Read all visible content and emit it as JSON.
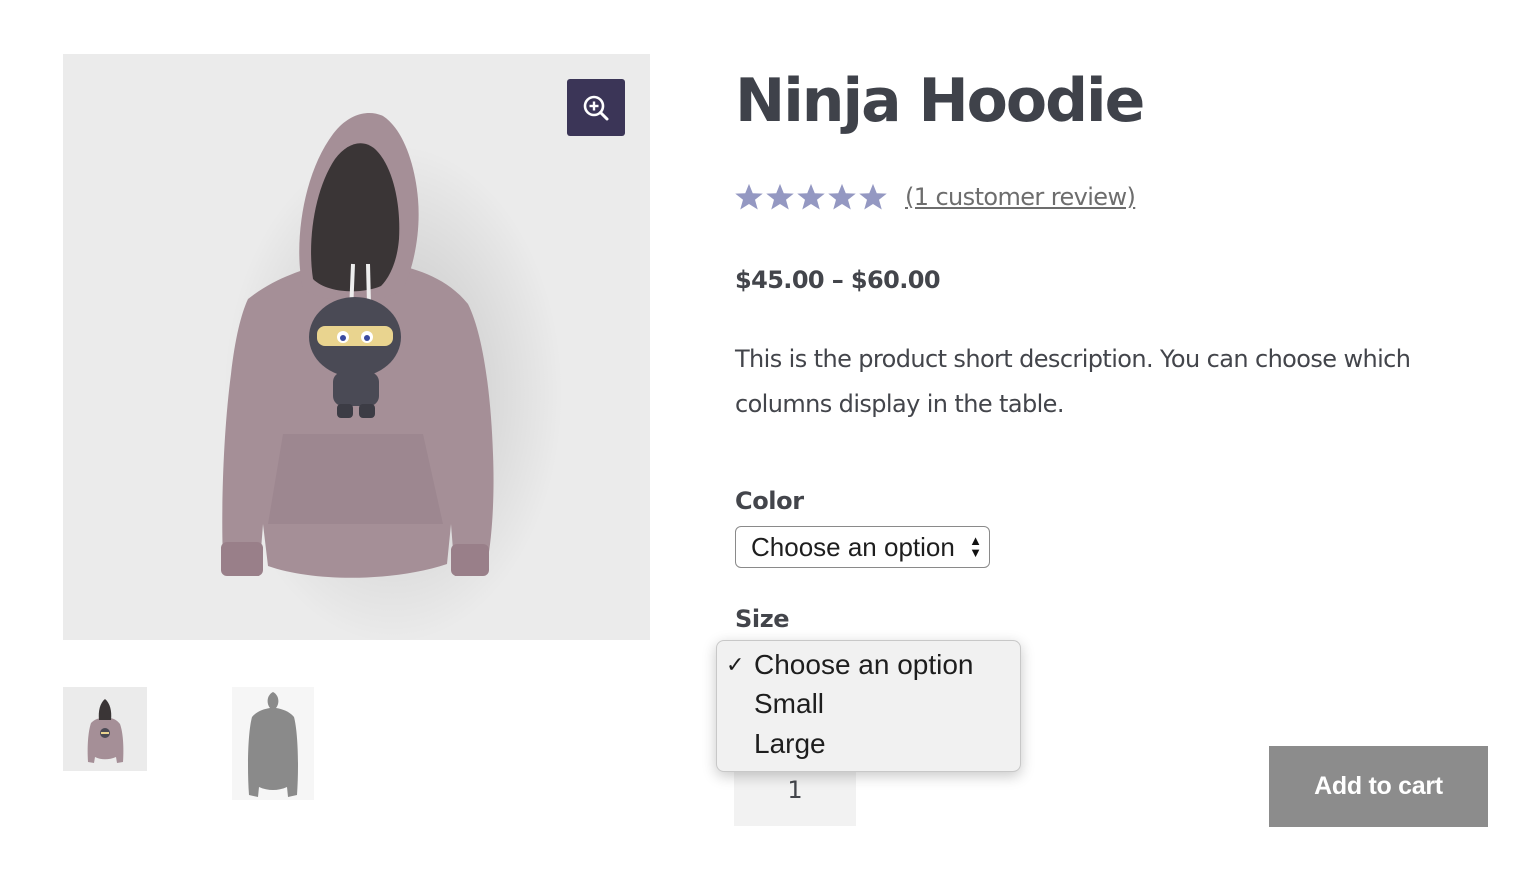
{
  "product": {
    "title": "Ninja Hoodie",
    "rating": 5,
    "rating_max": 5,
    "review_link": "(1 customer review)",
    "price": "$45.00 – $60.00",
    "short_description": "This is the product short description. You can choose which columns display in the table."
  },
  "gallery": {
    "zoom_icon": "zoom-in-icon",
    "thumbnails": [
      "hoodie-front-thumbnail",
      "hoodie-back-thumbnail"
    ]
  },
  "variations": {
    "color": {
      "label": "Color",
      "selected": "Choose an option"
    },
    "size": {
      "label": "Size",
      "options": [
        "Choose an option",
        "Small",
        "Large"
      ],
      "selected": "Choose an option"
    }
  },
  "cart": {
    "quantity": "1",
    "add_to_cart_label": "Add to cart"
  },
  "colors": {
    "accent": "#3b3557",
    "star": "#9498c2",
    "button": "#8c8c8c",
    "hoodie": "#a58f97"
  }
}
